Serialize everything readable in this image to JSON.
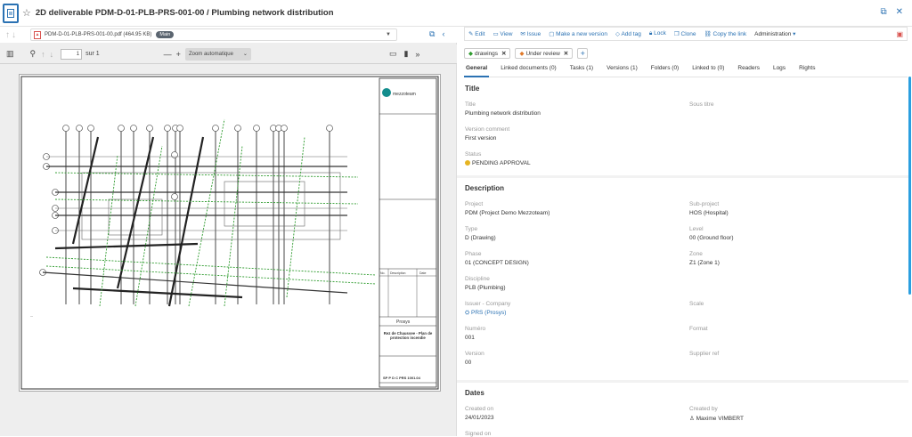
{
  "header": {
    "title": "2D deliverable PDM-D-01-PLB-PRS-001-00 / Plumbing network distribution"
  },
  "viewer": {
    "file_name": "PDM-D-01-PLB-PRS-001-00.pdf (464.95 KB)",
    "branch_badge": "Main",
    "page_input": "1",
    "page_total": "sur 1",
    "zoom": "Zoom automatique",
    "drawing": {
      "logo_text": "mezzoteam",
      "col_no": "No.",
      "col_desc": "Description",
      "col_date": "Date",
      "company": "Prosys",
      "drawing_title": "Rez de Chaussee - Plan de protection incendie",
      "ref": "SP P D C PRS 1001.04"
    }
  },
  "actions": [
    "Edit",
    "View",
    "Issue",
    "Make a new version",
    "Add tag",
    "Lock",
    "Clone",
    "Copy the link"
  ],
  "admin_label": "Administration",
  "tags": [
    "drawings",
    "Under review"
  ],
  "tabs": [
    "General",
    "Linked documents (0)",
    "Tasks (1)",
    "Versions (1)",
    "Folders (0)",
    "Linked to (0)",
    "Readers",
    "Logs",
    "Rights"
  ],
  "title_section": {
    "heading": "Title",
    "title_label": "Title",
    "title_value": "Plumbing network distribution",
    "subtitle_label": "Sous titre",
    "version_comment_label": "Version comment",
    "version_comment_value": "First version",
    "status_label": "Status",
    "status_value": "PENDING APPROVAL"
  },
  "description_section": {
    "heading": "Description",
    "project_label": "Project",
    "project_value": "PDM (Project Demo Mezzoteam)",
    "subproject_label": "Sub-project",
    "subproject_value": "HOS (Hospital)",
    "type_label": "Type",
    "type_value": "D (Drawing)",
    "level_label": "Level",
    "level_value": "00 (Ground floor)",
    "phase_label": "Phase",
    "phase_value": "01 (CONCEPT DESIGN)",
    "zone_label": "Zone",
    "zone_value": "Z1 (Zone 1)",
    "discipline_label": "Discipline",
    "discipline_value": "PLB (Plumbing)",
    "issuer_label": "Issuer - Company",
    "issuer_value": "PRS (Prosys)",
    "scale_label": "Scale",
    "numero_label": "Numéro",
    "numero_value": "001",
    "format_label": "Format",
    "version_label": "Version",
    "version_value": "00",
    "supplier_label": "Supplier ref"
  },
  "dates_section": {
    "heading": "Dates",
    "created_on_label": "Created on",
    "created_on_value": "24/01/2023",
    "created_by_label": "Created by",
    "created_by_value": "Maxime VIMBERT",
    "signed_on_label": "Signed on"
  },
  "colors": {
    "accent": "#2b72b3",
    "status_pending": "#e6b422",
    "pdf_red": "#d9534f"
  }
}
